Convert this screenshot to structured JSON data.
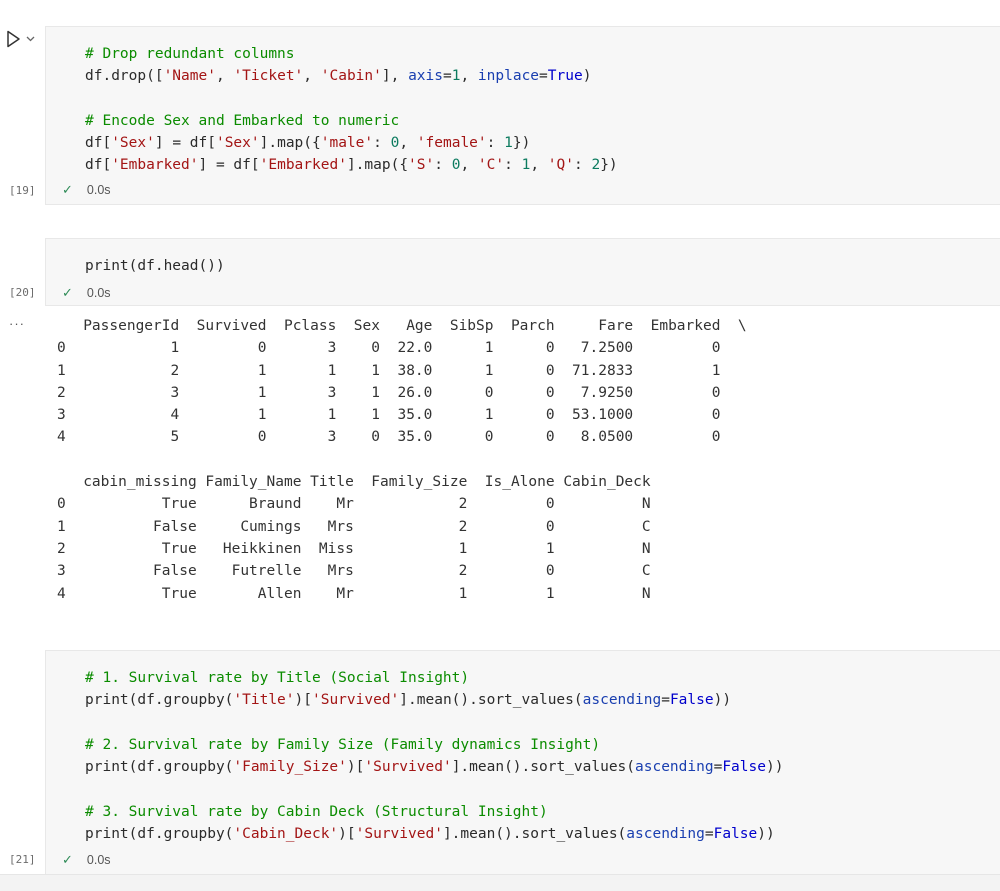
{
  "cells": [
    {
      "exec_count": "[19]",
      "time": "0.0s",
      "lines": [
        [
          [
            "c",
            "# Drop redundant columns"
          ]
        ],
        [
          [
            "t",
            "df.drop(["
          ],
          [
            "s",
            "'Name'"
          ],
          [
            "t",
            ", "
          ],
          [
            "s",
            "'Ticket'"
          ],
          [
            "t",
            ", "
          ],
          [
            "s",
            "'Cabin'"
          ],
          [
            "t",
            "], "
          ],
          [
            "p",
            "axis"
          ],
          [
            "t",
            "="
          ],
          [
            "n",
            "1"
          ],
          [
            "t",
            ", "
          ],
          [
            "p",
            "inplace"
          ],
          [
            "t",
            "="
          ],
          [
            "k",
            "True"
          ],
          [
            "t",
            ")"
          ]
        ],
        [],
        [
          [
            "c",
            "# Encode Sex and Embarked to numeric"
          ]
        ],
        [
          [
            "t",
            "df["
          ],
          [
            "s",
            "'Sex'"
          ],
          [
            "t",
            "] = df["
          ],
          [
            "s",
            "'Sex'"
          ],
          [
            "t",
            "].map({"
          ],
          [
            "s",
            "'male'"
          ],
          [
            "t",
            ": "
          ],
          [
            "n",
            "0"
          ],
          [
            "t",
            ", "
          ],
          [
            "s",
            "'female'"
          ],
          [
            "t",
            ": "
          ],
          [
            "n",
            "1"
          ],
          [
            "t",
            "})"
          ]
        ],
        [
          [
            "t",
            "df["
          ],
          [
            "s",
            "'Embarked'"
          ],
          [
            "t",
            "] = df["
          ],
          [
            "s",
            "'Embarked'"
          ],
          [
            "t",
            "].map({"
          ],
          [
            "s",
            "'S'"
          ],
          [
            "t",
            ": "
          ],
          [
            "n",
            "0"
          ],
          [
            "t",
            ", "
          ],
          [
            "s",
            "'C'"
          ],
          [
            "t",
            ": "
          ],
          [
            "n",
            "1"
          ],
          [
            "t",
            ", "
          ],
          [
            "s",
            "'Q'"
          ],
          [
            "t",
            ": "
          ],
          [
            "n",
            "2"
          ],
          [
            "t",
            "})"
          ]
        ]
      ]
    },
    {
      "exec_count": "[20]",
      "time": "0.0s",
      "lines": [
        [
          [
            "t",
            "print(df.head())"
          ]
        ]
      ]
    },
    {
      "exec_count": "[21]",
      "time": "0.0s",
      "lines": [
        [
          [
            "c",
            "# 1. Survival rate by Title (Social Insight)"
          ]
        ],
        [
          [
            "t",
            "print(df.groupby("
          ],
          [
            "s",
            "'Title'"
          ],
          [
            "t",
            ")["
          ],
          [
            "s",
            "'Survived'"
          ],
          [
            "t",
            "].mean().sort_values("
          ],
          [
            "p",
            "ascending"
          ],
          [
            "t",
            "="
          ],
          [
            "k",
            "False"
          ],
          [
            "t",
            "))"
          ]
        ],
        [],
        [
          [
            "c",
            "# 2. Survival rate by Family Size (Family dynamics Insight)"
          ]
        ],
        [
          [
            "t",
            "print(df.groupby("
          ],
          [
            "s",
            "'Family_Size'"
          ],
          [
            "t",
            ")["
          ],
          [
            "s",
            "'Survived'"
          ],
          [
            "t",
            "].mean().sort_values("
          ],
          [
            "p",
            "ascending"
          ],
          [
            "t",
            "="
          ],
          [
            "k",
            "False"
          ],
          [
            "t",
            "))"
          ]
        ],
        [],
        [
          [
            "c",
            "# 3. Survival rate by Cabin Deck (Structural Insight)"
          ]
        ],
        [
          [
            "t",
            "print(df.groupby("
          ],
          [
            "s",
            "'Cabin_Deck'"
          ],
          [
            "t",
            ")["
          ],
          [
            "s",
            "'Survived'"
          ],
          [
            "t",
            "].mean().sort_values("
          ],
          [
            "p",
            "ascending"
          ],
          [
            "t",
            "="
          ],
          [
            "k",
            "False"
          ],
          [
            "t",
            "))"
          ]
        ]
      ]
    }
  ],
  "output": {
    "ellipsis": "···",
    "lines": [
      "   PassengerId  Survived  Pclass  Sex   Age  SibSp  Parch     Fare  Embarked  \\",
      "0            1         0       3    0  22.0      1      0   7.2500         0   ",
      "1            2         1       1    1  38.0      1      0  71.2833         1   ",
      "2            3         1       3    1  26.0      0      0   7.9250         0   ",
      "3            4         1       1    1  35.0      1      0  53.1000         0   ",
      "4            5         0       3    0  35.0      0      0   8.0500         0   ",
      "",
      "   cabin_missing Family_Name Title  Family_Size  Is_Alone Cabin_Deck  ",
      "0           True      Braund    Mr            2         0          N  ",
      "1          False     Cumings   Mrs            2         0          C  ",
      "2           True   Heikkinen  Miss            1         1          N  ",
      "3          False    Futrelle   Mrs            2         0          C  ",
      "4           True       Allen    Mr            1         1          N  "
    ]
  },
  "icons": {
    "run": "run-cell-icon",
    "chevron": "chevron-down-icon",
    "check": "check-icon"
  },
  "colors": {
    "comment": "#0b8c00",
    "string": "#a31515",
    "number": "#0c7b5f",
    "keyword": "#0000cc",
    "success": "#2e8b57"
  }
}
